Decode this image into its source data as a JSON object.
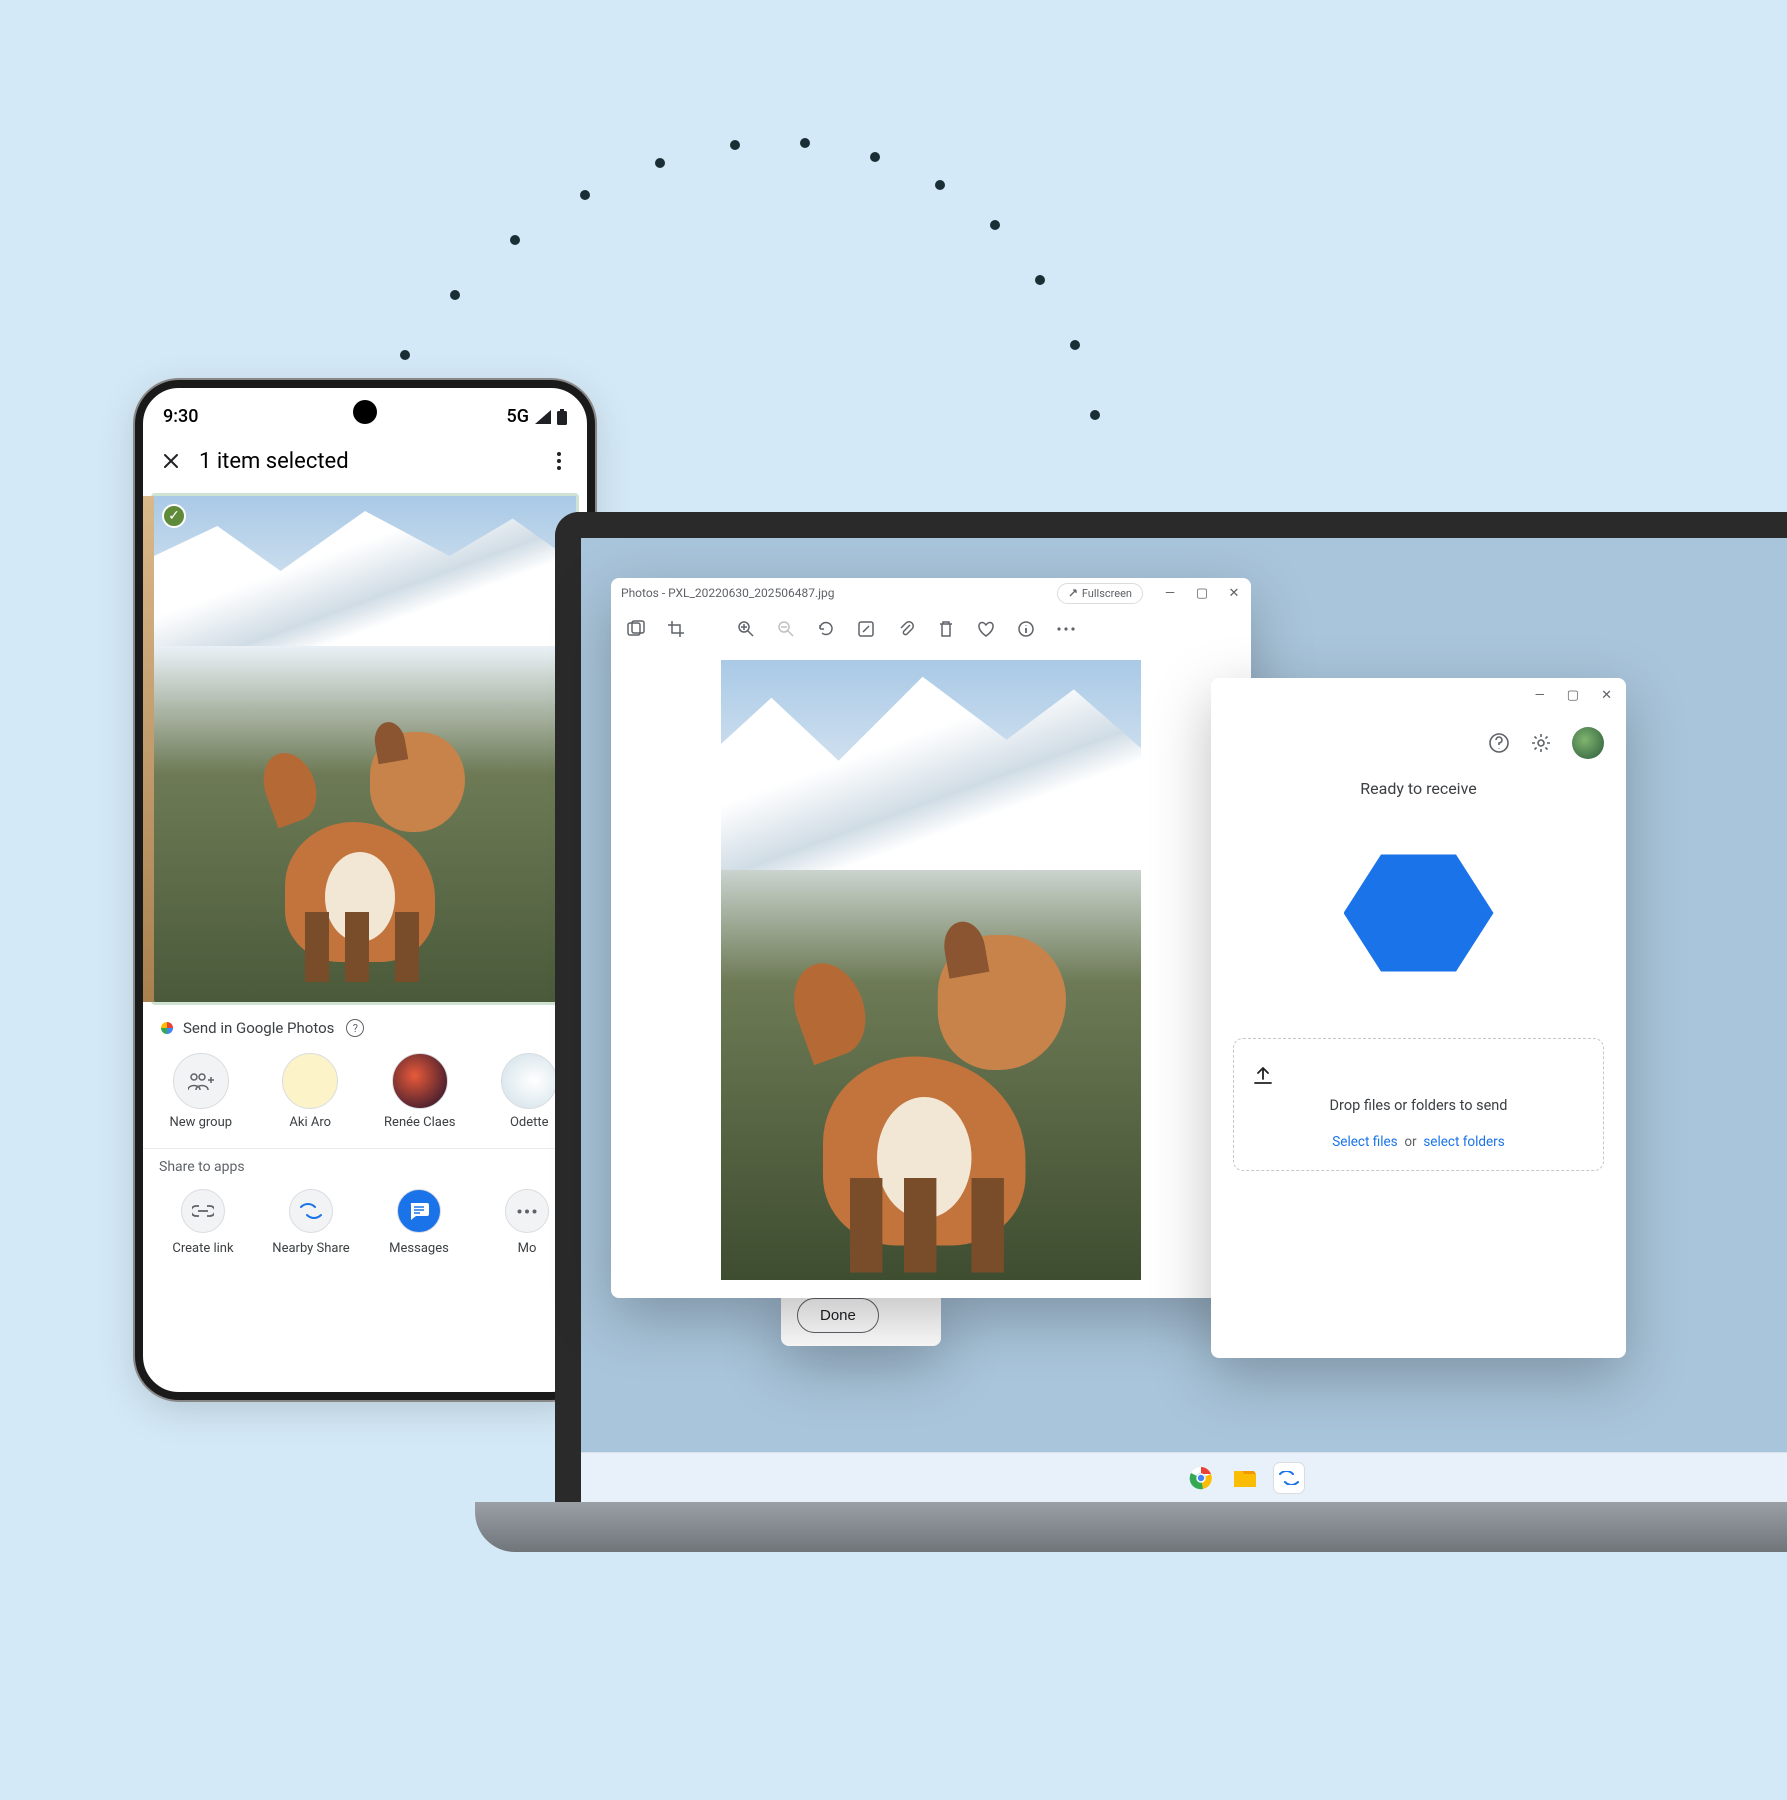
{
  "phone": {
    "status": {
      "time": "9:30",
      "network": "5G"
    },
    "appbar": {
      "title": "1 item selected"
    },
    "send_label": "Send in Google Photos",
    "contacts": [
      {
        "name": "New group",
        "icon": "group"
      },
      {
        "name": "Aki Aro"
      },
      {
        "name": "Renée Claes"
      },
      {
        "name": "Odette"
      }
    ],
    "share_apps_label": "Share to apps",
    "apps": [
      {
        "name": "Create link"
      },
      {
        "name": "Nearby Share"
      },
      {
        "name": "Messages"
      },
      {
        "name": "Mo"
      }
    ]
  },
  "laptop": {
    "photos_window": {
      "title": "Photos - PXL_20220630_202506487.jpg",
      "fullscreen_label": "Fullscreen"
    },
    "done_label": "Done",
    "share_window": {
      "title": "Ready to receive",
      "drop_text": "Drop files or folders to send",
      "select_files": "Select files",
      "or": "or",
      "select_folders": "select folders"
    }
  }
}
